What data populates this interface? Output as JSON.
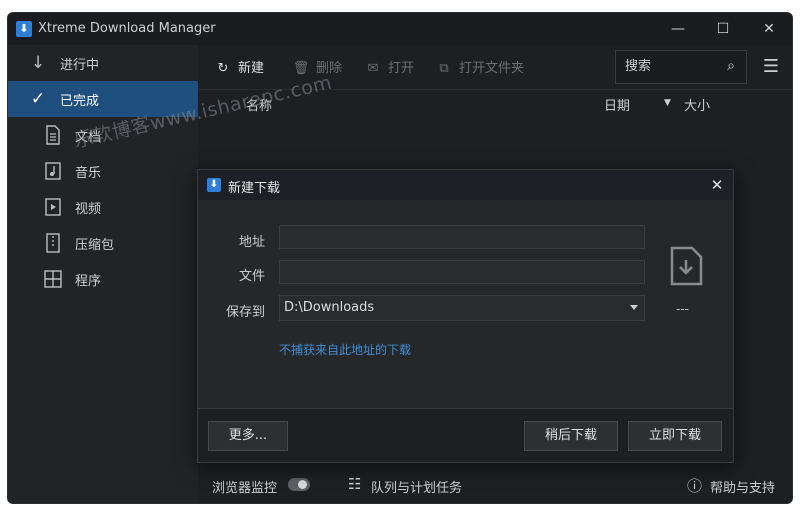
{
  "window": {
    "title": "Xtreme Download Manager",
    "min": "—",
    "max": "☐",
    "close": "✕"
  },
  "sidebar": {
    "items": [
      {
        "label": "进行中",
        "icon": "arrow-down-icon",
        "active": false
      },
      {
        "label": "已完成",
        "icon": "checkmark-icon",
        "active": true
      },
      {
        "label": "文档",
        "icon": "document-icon",
        "active": false
      },
      {
        "label": "音乐",
        "icon": "music-icon",
        "active": false
      },
      {
        "label": "视频",
        "icon": "video-icon",
        "active": false
      },
      {
        "label": "压缩包",
        "icon": "archive-icon",
        "active": false
      },
      {
        "label": "程序",
        "icon": "program-icon",
        "active": false
      }
    ]
  },
  "toolbar": {
    "new_label": "新建",
    "delete_label": "删除",
    "open_label": "打开",
    "open_folder_label": "打开文件夹",
    "search_placeholder": "搜索"
  },
  "columns": {
    "name": "名称",
    "date": "日期",
    "size": "大小"
  },
  "watermark": "乐软博客www.isharepc.com",
  "footer": {
    "browser_monitor": "浏览器监控",
    "queue_label": "队列与计划任务",
    "help_label": "帮助与支持"
  },
  "dialog": {
    "title": "新建下载",
    "address_label": "地址",
    "address_value": "",
    "file_label": "文件",
    "file_value": "",
    "save_to_label": "保存到",
    "save_to_value": "D:\\Downloads",
    "ignore_link": "不捕获来自此地址的下载",
    "size_text": "---",
    "more_button": "更多...",
    "later_button": "稍后下载",
    "now_button": "立即下载"
  },
  "colors": {
    "accent": "#1f4f7f",
    "link": "#3e8fd8",
    "background": "#1e1f22"
  }
}
